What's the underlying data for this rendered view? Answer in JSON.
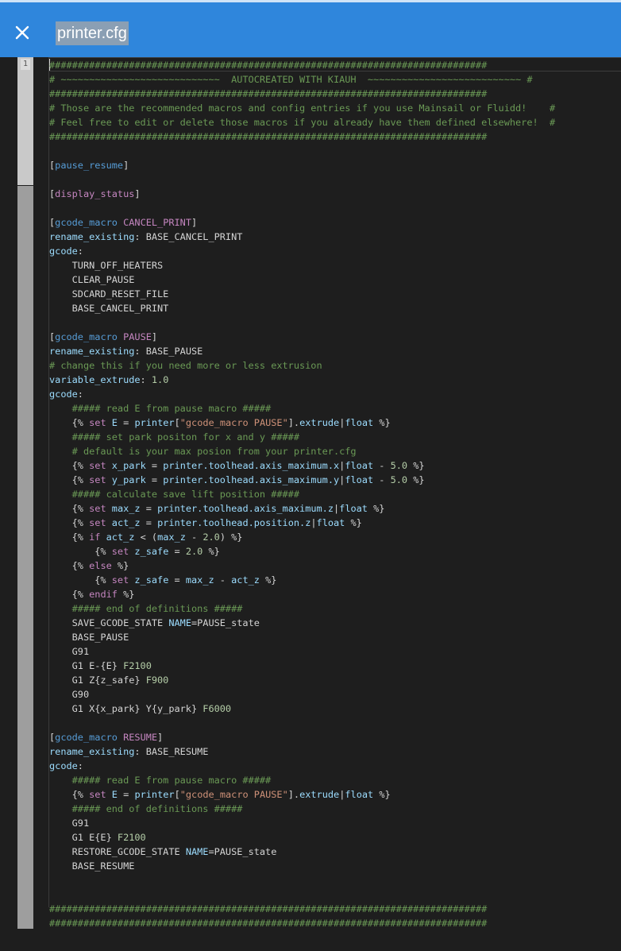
{
  "header": {
    "close_icon": "close-icon",
    "file_name": "printer.cfg",
    "bg_color": "#2f86dc"
  },
  "editor": {
    "line_number": "1",
    "lines": [
      [
        {
          "t": "c",
          "v": "#############################################################################"
        }
      ],
      [
        {
          "t": "c",
          "v": "# ~~~~~~~~~~~~~~~~~~~~~~~~~~~~  AUTOCREATED WITH KIAUH  ~~~~~~~~~~~~~~~~~~~~~~~~~~~ #"
        }
      ],
      [
        {
          "t": "c",
          "v": "#############################################################################"
        }
      ],
      [
        {
          "t": "c",
          "v": "# Those are the recommended macros and config entries if you use Mainsail or Fluidd!    #"
        }
      ],
      [
        {
          "t": "c",
          "v": "# Feel free to edit or delete those macros if you already have them defined elsewhere!  #"
        }
      ],
      [
        {
          "t": "c",
          "v": "#############################################################################"
        }
      ],
      [],
      [
        {
          "t": "p",
          "v": "["
        },
        {
          "t": "s",
          "v": "pause_resume"
        },
        {
          "t": "p",
          "v": "]"
        }
      ],
      [],
      [
        {
          "t": "p",
          "v": "["
        },
        {
          "t": "m",
          "v": "display_status"
        },
        {
          "t": "p",
          "v": "]"
        }
      ],
      [],
      [
        {
          "t": "p",
          "v": "["
        },
        {
          "t": "s",
          "v": "gcode_macro"
        },
        {
          "t": "p",
          "v": " "
        },
        {
          "t": "m",
          "v": "CANCEL_PRINT"
        },
        {
          "t": "p",
          "v": "]"
        }
      ],
      [
        {
          "t": "k",
          "v": "rename_existing"
        },
        {
          "t": "p",
          "v": ": BASE_CANCEL_PRINT"
        }
      ],
      [
        {
          "t": "k",
          "v": "gcode"
        },
        {
          "t": "p",
          "v": ":"
        }
      ],
      [
        {
          "t": "p",
          "v": "    TURN_OFF_HEATERS"
        }
      ],
      [
        {
          "t": "p",
          "v": "    CLEAR_PAUSE"
        }
      ],
      [
        {
          "t": "p",
          "v": "    SDCARD_RESET_FILE"
        }
      ],
      [
        {
          "t": "p",
          "v": "    BASE_CANCEL_PRINT"
        }
      ],
      [],
      [
        {
          "t": "p",
          "v": "["
        },
        {
          "t": "s",
          "v": "gcode_macro"
        },
        {
          "t": "p",
          "v": " "
        },
        {
          "t": "m",
          "v": "PAUSE"
        },
        {
          "t": "p",
          "v": "]"
        }
      ],
      [
        {
          "t": "k",
          "v": "rename_existing"
        },
        {
          "t": "p",
          "v": ": BASE_PAUSE"
        }
      ],
      [
        {
          "t": "c",
          "v": "# change this if you need more or less extrusion"
        }
      ],
      [
        {
          "t": "k",
          "v": "variable_extrude"
        },
        {
          "t": "p",
          "v": ": "
        },
        {
          "t": "n",
          "v": "1.0"
        }
      ],
      [
        {
          "t": "k",
          "v": "gcode"
        },
        {
          "t": "p",
          "v": ":"
        }
      ],
      [
        {
          "t": "c",
          "v": "    ##### read E from pause macro #####"
        }
      ],
      [
        {
          "t": "p",
          "v": "    {% "
        },
        {
          "t": "m",
          "v": "set"
        },
        {
          "t": "p",
          "v": " "
        },
        {
          "t": "k",
          "v": "E"
        },
        {
          "t": "p",
          "v": " = "
        },
        {
          "t": "k",
          "v": "printer"
        },
        {
          "t": "p",
          "v": "["
        },
        {
          "t": "str",
          "v": "\"gcode_macro PAUSE\""
        },
        {
          "t": "p",
          "v": "]."
        },
        {
          "t": "k",
          "v": "extrude"
        },
        {
          "t": "p",
          "v": "|"
        },
        {
          "t": "k",
          "v": "float"
        },
        {
          "t": "p",
          "v": " %}"
        }
      ],
      [
        {
          "t": "c",
          "v": "    ##### set park positon for x and y #####"
        }
      ],
      [
        {
          "t": "c",
          "v": "    # default is your max posion from your printer.cfg"
        }
      ],
      [
        {
          "t": "p",
          "v": "    {% "
        },
        {
          "t": "m",
          "v": "set"
        },
        {
          "t": "p",
          "v": " "
        },
        {
          "t": "k",
          "v": "x_park"
        },
        {
          "t": "p",
          "v": " = "
        },
        {
          "t": "k",
          "v": "printer.toolhead.axis_maximum.x"
        },
        {
          "t": "p",
          "v": "|"
        },
        {
          "t": "k",
          "v": "float"
        },
        {
          "t": "p",
          "v": " - "
        },
        {
          "t": "n",
          "v": "5.0"
        },
        {
          "t": "p",
          "v": " %}"
        }
      ],
      [
        {
          "t": "p",
          "v": "    {% "
        },
        {
          "t": "m",
          "v": "set"
        },
        {
          "t": "p",
          "v": " "
        },
        {
          "t": "k",
          "v": "y_park"
        },
        {
          "t": "p",
          "v": " = "
        },
        {
          "t": "k",
          "v": "printer.toolhead.axis_maximum.y"
        },
        {
          "t": "p",
          "v": "|"
        },
        {
          "t": "k",
          "v": "float"
        },
        {
          "t": "p",
          "v": " - "
        },
        {
          "t": "n",
          "v": "5.0"
        },
        {
          "t": "p",
          "v": " %}"
        }
      ],
      [
        {
          "t": "c",
          "v": "    ##### calculate save lift position #####"
        }
      ],
      [
        {
          "t": "p",
          "v": "    {% "
        },
        {
          "t": "m",
          "v": "set"
        },
        {
          "t": "p",
          "v": " "
        },
        {
          "t": "k",
          "v": "max_z"
        },
        {
          "t": "p",
          "v": " = "
        },
        {
          "t": "k",
          "v": "printer.toolhead.axis_maximum.z"
        },
        {
          "t": "p",
          "v": "|"
        },
        {
          "t": "k",
          "v": "float"
        },
        {
          "t": "p",
          "v": " %}"
        }
      ],
      [
        {
          "t": "p",
          "v": "    {% "
        },
        {
          "t": "m",
          "v": "set"
        },
        {
          "t": "p",
          "v": " "
        },
        {
          "t": "k",
          "v": "act_z"
        },
        {
          "t": "p",
          "v": " = "
        },
        {
          "t": "k",
          "v": "printer.toolhead.position.z"
        },
        {
          "t": "p",
          "v": "|"
        },
        {
          "t": "k",
          "v": "float"
        },
        {
          "t": "p",
          "v": " %}"
        }
      ],
      [
        {
          "t": "p",
          "v": "    {% "
        },
        {
          "t": "m",
          "v": "if"
        },
        {
          "t": "p",
          "v": " "
        },
        {
          "t": "k",
          "v": "act_z"
        },
        {
          "t": "p",
          "v": " < ("
        },
        {
          "t": "k",
          "v": "max_z"
        },
        {
          "t": "p",
          "v": " - "
        },
        {
          "t": "n",
          "v": "2.0"
        },
        {
          "t": "p",
          "v": ") %}"
        }
      ],
      [
        {
          "t": "p",
          "v": "        {% "
        },
        {
          "t": "m",
          "v": "set"
        },
        {
          "t": "p",
          "v": " "
        },
        {
          "t": "k",
          "v": "z_safe"
        },
        {
          "t": "p",
          "v": " = "
        },
        {
          "t": "n",
          "v": "2.0"
        },
        {
          "t": "p",
          "v": " %}"
        }
      ],
      [
        {
          "t": "p",
          "v": "    {% "
        },
        {
          "t": "m",
          "v": "else"
        },
        {
          "t": "p",
          "v": " %}"
        }
      ],
      [
        {
          "t": "p",
          "v": "        {% "
        },
        {
          "t": "m",
          "v": "set"
        },
        {
          "t": "p",
          "v": " "
        },
        {
          "t": "k",
          "v": "z_safe"
        },
        {
          "t": "p",
          "v": " = "
        },
        {
          "t": "k",
          "v": "max_z"
        },
        {
          "t": "p",
          "v": " - "
        },
        {
          "t": "k",
          "v": "act_z"
        },
        {
          "t": "p",
          "v": " %}"
        }
      ],
      [
        {
          "t": "p",
          "v": "    {% "
        },
        {
          "t": "m",
          "v": "endif"
        },
        {
          "t": "p",
          "v": " %}"
        }
      ],
      [
        {
          "t": "c",
          "v": "    ##### end of definitions #####"
        }
      ],
      [
        {
          "t": "p",
          "v": "    SAVE_GCODE_STATE "
        },
        {
          "t": "k",
          "v": "NAME"
        },
        {
          "t": "p",
          "v": "=PAUSE_state"
        }
      ],
      [
        {
          "t": "p",
          "v": "    BASE_PAUSE"
        }
      ],
      [
        {
          "t": "p",
          "v": "    G91"
        }
      ],
      [
        {
          "t": "p",
          "v": "    G1 E-{E} "
        },
        {
          "t": "n",
          "v": "F2100"
        }
      ],
      [
        {
          "t": "p",
          "v": "    G1 Z{z_safe} "
        },
        {
          "t": "n",
          "v": "F900"
        }
      ],
      [
        {
          "t": "p",
          "v": "    G90"
        }
      ],
      [
        {
          "t": "p",
          "v": "    G1 X{x_park} Y{y_park} "
        },
        {
          "t": "n",
          "v": "F6000"
        }
      ],
      [],
      [
        {
          "t": "p",
          "v": "["
        },
        {
          "t": "s",
          "v": "gcode_macro"
        },
        {
          "t": "p",
          "v": " "
        },
        {
          "t": "m",
          "v": "RESUME"
        },
        {
          "t": "p",
          "v": "]"
        }
      ],
      [
        {
          "t": "k",
          "v": "rename_existing"
        },
        {
          "t": "p",
          "v": ": BASE_RESUME"
        }
      ],
      [
        {
          "t": "k",
          "v": "gcode"
        },
        {
          "t": "p",
          "v": ":"
        }
      ],
      [
        {
          "t": "c",
          "v": "    ##### read E from pause macro #####"
        }
      ],
      [
        {
          "t": "p",
          "v": "    {% "
        },
        {
          "t": "m",
          "v": "set"
        },
        {
          "t": "p",
          "v": " "
        },
        {
          "t": "k",
          "v": "E"
        },
        {
          "t": "p",
          "v": " = "
        },
        {
          "t": "k",
          "v": "printer"
        },
        {
          "t": "p",
          "v": "["
        },
        {
          "t": "str",
          "v": "\"gcode_macro PAUSE\""
        },
        {
          "t": "p",
          "v": "]."
        },
        {
          "t": "k",
          "v": "extrude"
        },
        {
          "t": "p",
          "v": "|"
        },
        {
          "t": "k",
          "v": "float"
        },
        {
          "t": "p",
          "v": " %}"
        }
      ],
      [
        {
          "t": "c",
          "v": "    ##### end of definitions #####"
        }
      ],
      [
        {
          "t": "p",
          "v": "    G91"
        }
      ],
      [
        {
          "t": "p",
          "v": "    G1 E{E} "
        },
        {
          "t": "n",
          "v": "F2100"
        }
      ],
      [
        {
          "t": "p",
          "v": "    RESTORE_GCODE_STATE "
        },
        {
          "t": "k",
          "v": "NAME"
        },
        {
          "t": "p",
          "v": "=PAUSE_state"
        }
      ],
      [
        {
          "t": "p",
          "v": "    BASE_RESUME"
        }
      ],
      [],
      [],
      [
        {
          "t": "c",
          "v": "#############################################################################"
        }
      ],
      [
        {
          "t": "c",
          "v": "#############################################################################"
        }
      ]
    ]
  }
}
